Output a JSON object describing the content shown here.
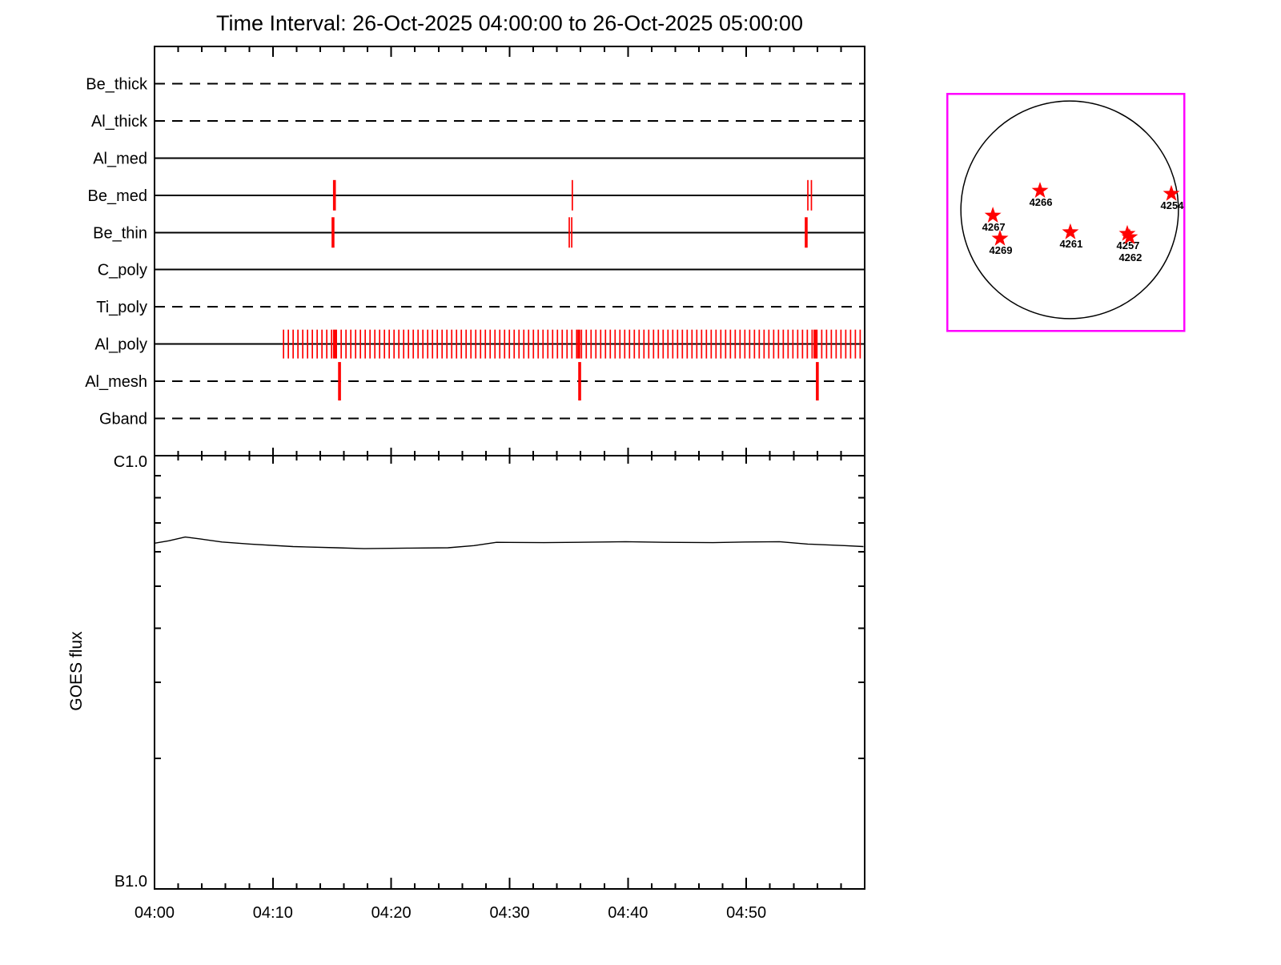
{
  "title": "Time Interval: 26-Oct-2025 04:00:00 to 26-Oct-2025 05:00:00",
  "colors": {
    "background": "#ffffff",
    "axis": "#000000",
    "exposure_tick": "#ff0000",
    "inset_border": "#ff00ff",
    "active_region_star": "#ff0000"
  },
  "chart_data": {
    "type": "timeline+line",
    "title": "Time Interval: 26-Oct-2025 04:00:00 to 26-Oct-2025 05:00:00",
    "time_axis": {
      "start": "04:00",
      "end": "05:00",
      "tick_labels": [
        "04:00",
        "04:10",
        "04:20",
        "04:30",
        "04:40",
        "04:50"
      ],
      "minor_tick_min": 2,
      "major_tick_min": 10
    },
    "filter_panel": {
      "filters": [
        {
          "name": "Be_thick",
          "line_style": "dashed",
          "exposures": []
        },
        {
          "name": "Al_thick",
          "line_style": "dashed",
          "exposures": []
        },
        {
          "name": "Al_med",
          "line_style": "solid",
          "exposures": []
        },
        {
          "name": "Be_med",
          "line_style": "solid",
          "exposures": [
            {
              "t": 15.2,
              "w": "thick"
            },
            {
              "t": 35.3,
              "w": "thin"
            },
            {
              "t": 55.2,
              "w": "thin"
            },
            {
              "t": 55.5,
              "w": "thin"
            }
          ]
        },
        {
          "name": "Be_thin",
          "line_style": "solid",
          "exposures": [
            {
              "t": 15.08,
              "w": "thick"
            },
            {
              "t": 35.04,
              "w": "thin"
            },
            {
              "t": 35.25,
              "w": "thin"
            },
            {
              "t": 55.06,
              "w": "thick"
            }
          ]
        },
        {
          "name": "C_poly",
          "line_style": "solid",
          "exposures": []
        },
        {
          "name": "Ti_poly",
          "line_style": "dashed",
          "exposures": []
        },
        {
          "name": "Al_poly",
          "line_style": "solid",
          "exposures": [
            {
              "t": 15.2,
              "w": "thick"
            },
            {
              "t": 35.85,
              "w": "thick"
            },
            {
              "t": 55.8,
              "w": "thick"
            }
          ],
          "exposure_train": {
            "start_min": 10.9,
            "end_min": 59.9,
            "step_min": 0.406
          }
        },
        {
          "name": "Al_mesh",
          "line_style": "dashed",
          "exposures": [
            {
              "t": 15.63,
              "w": "thick"
            },
            {
              "t": 35.92,
              "w": "thick"
            },
            {
              "t": 56.0,
              "w": "thick"
            }
          ]
        },
        {
          "name": "Gband",
          "line_style": "dashed",
          "exposures": []
        }
      ]
    },
    "goes_panel": {
      "ylabel": "GOES flux",
      "y_top_label": "C1.0",
      "y_bottom_label": "B1.0",
      "y_scale": "log",
      "flux_units": "1e-7 W/m^2",
      "series": [
        {
          "name": "GOES flux",
          "points": [
            [
              0,
              6.28
            ],
            [
              1.2,
              6.36
            ],
            [
              2.6,
              6.49
            ],
            [
              3.9,
              6.42
            ],
            [
              5.7,
              6.32
            ],
            [
              8.1,
              6.25
            ],
            [
              11.7,
              6.17
            ],
            [
              15.4,
              6.13
            ],
            [
              17.7,
              6.1
            ],
            [
              21.6,
              6.12
            ],
            [
              24.8,
              6.13
            ],
            [
              27.0,
              6.2
            ],
            [
              28.9,
              6.31
            ],
            [
              32.9,
              6.3
            ],
            [
              35.7,
              6.31
            ],
            [
              39.8,
              6.33
            ],
            [
              43.1,
              6.31
            ],
            [
              47.2,
              6.3
            ],
            [
              49.9,
              6.32
            ],
            [
              52.8,
              6.33
            ],
            [
              55.2,
              6.25
            ],
            [
              58.3,
              6.2
            ],
            [
              59.9,
              6.17
            ]
          ]
        }
      ]
    },
    "solar_disk_inset": {
      "active_regions": [
        {
          "number": "4266",
          "x": 0.392,
          "y": 0.409
        },
        {
          "number": "4254",
          "x": 0.946,
          "y": 0.422
        },
        {
          "number": "4267",
          "x": 0.193,
          "y": 0.514
        },
        {
          "number": "4269",
          "x": 0.223,
          "y": 0.611
        },
        {
          "number": "4261",
          "x": 0.52,
          "y": 0.584
        },
        {
          "number": "4257",
          "x": 0.76,
          "y": 0.591
        },
        {
          "number": "4262",
          "x": 0.77,
          "y": 0.605,
          "label_dy": 25
        }
      ]
    }
  }
}
